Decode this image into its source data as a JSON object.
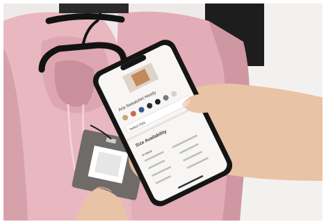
{
  "scene": {
    "description_hidden": "",
    "colors": {
      "frame": "#ffffff",
      "background_wall": "#efeaea",
      "hoodie_pink": "#e8b7c0",
      "hoodie_shadow": "#c98f9b",
      "hanger_black": "#121212",
      "dark_rack": "#1d1d1d",
      "skin": "#e9c3a6",
      "skin_shadow": "#c99f84",
      "phone_body": "#151515",
      "screen_bg": "#f7f6f4",
      "tag_gray": "#6f6b68"
    }
  },
  "phone": {
    "product_title": "Aria Sweatshirt Hoody",
    "section_title": "Size Availability",
    "size_label": "Select Size",
    "col_header": "In-Store",
    "swatch_colors": [
      "#c9a574",
      "#c46a4b",
      "#3a5a8a",
      "#2c2c3a",
      "#1e1e1e",
      "#7a7a7a",
      "#d8d0c4"
    ]
  },
  "tag": {
    "label": ""
  }
}
